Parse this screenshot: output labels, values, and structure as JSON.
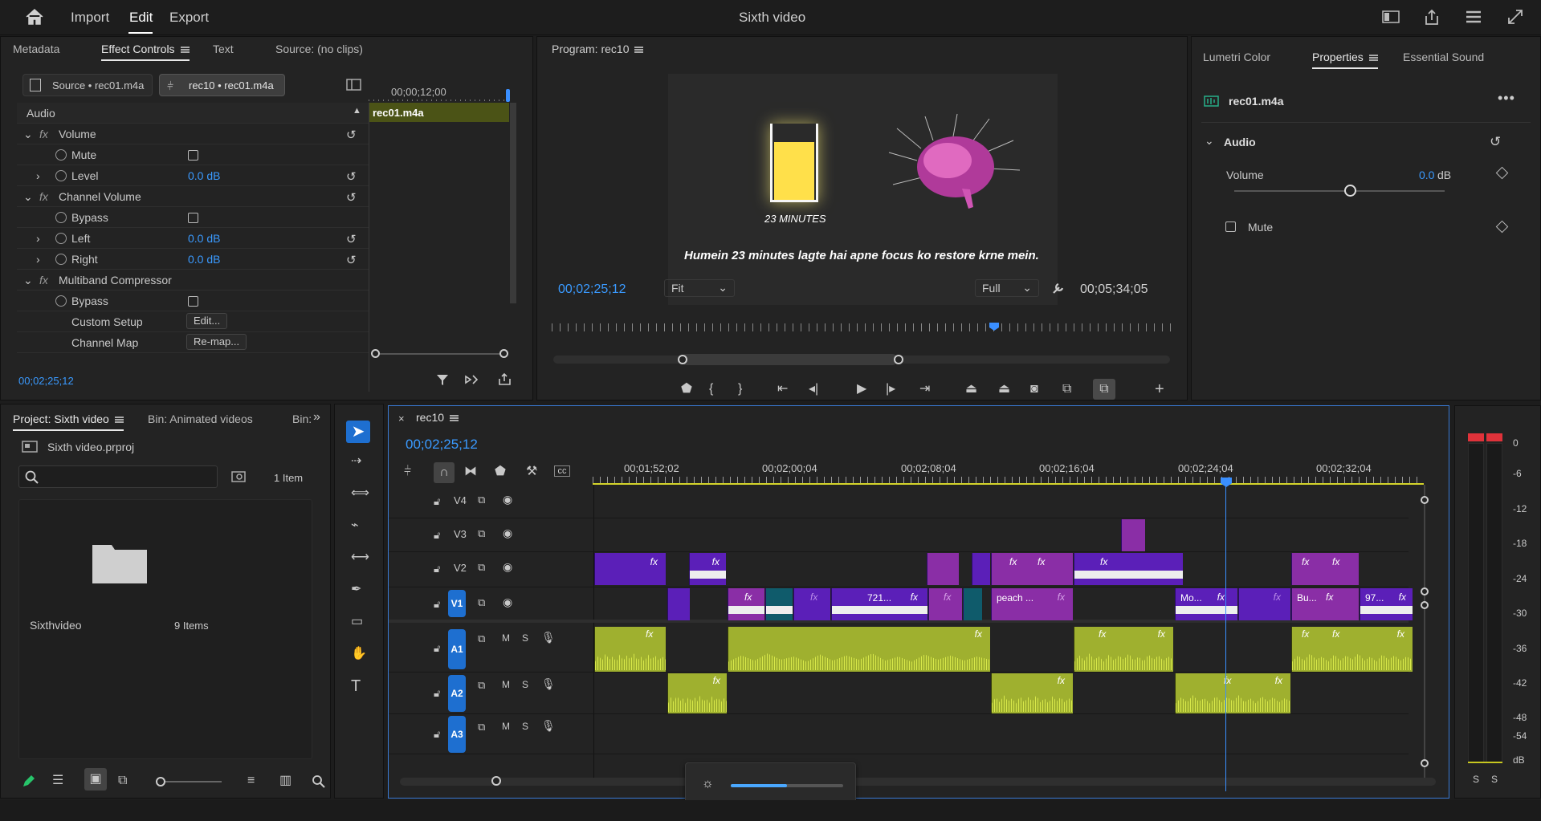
{
  "topbar": {
    "import": "Import",
    "edit": "Edit",
    "export": "Export",
    "title": "Sixth video"
  },
  "effect_controls": {
    "tabs": [
      "Metadata",
      "Effect Controls",
      "Text",
      "Source: (no clips)"
    ],
    "source_tab": "Source • rec01.m4a",
    "seq_tab": "rec10 • rec01.m4a",
    "mini_time": "00;00;12;00",
    "mini_clip": "rec01.m4a",
    "section": "Audio",
    "rows": {
      "volume": "Volume",
      "mute": "Mute",
      "level": "Level",
      "level_val": "0.0 dB",
      "channel_volume": "Channel Volume",
      "bypass": "Bypass",
      "left": "Left",
      "left_val": "0.0 dB",
      "right": "Right",
      "right_val": "0.0 dB",
      "multiband": "Multiband Compressor",
      "bypass2": "Bypass",
      "custom_setup": "Custom Setup",
      "edit_btn": "Edit...",
      "channel_map": "Channel Map",
      "remap_btn": "Re-map..."
    },
    "timecode": "00;02;25;12"
  },
  "program": {
    "title": "Program: rec10",
    "glass_caption": "23 MINUTES",
    "subtitle": "Humein 23 minutes lagte hai apne focus ko restore krne mein.",
    "timecode": "00;02;25;12",
    "fit": "Fit",
    "full": "Full",
    "duration": "00;05;34;05"
  },
  "properties": {
    "tabs": [
      "Lumetri Color",
      "Properties",
      "Essential Sound"
    ],
    "clip": "rec01.m4a",
    "section": "Audio",
    "volume_label": "Volume",
    "volume_val": "0.0",
    "volume_unit": "dB",
    "mute": "Mute",
    "volume_level": 0.55
  },
  "project": {
    "tabs": [
      "Project: Sixth video",
      "Bin: Animated videos",
      "Bin:"
    ],
    "file": "Sixth video.prproj",
    "count": "1 Item",
    "folder_name": "Sixthvideo",
    "folder_count": "9 Items"
  },
  "timeline": {
    "seq": "rec10",
    "timecode": "00;02;25;12",
    "ruler": [
      "00;01;52;02",
      "00;02;00;04",
      "00;02;08;04",
      "00;02;16;04",
      "00;02;24;04",
      "00;02;32;04"
    ],
    "video_tracks": [
      "V4",
      "V3",
      "V2",
      "V1"
    ],
    "audio_tracks": [
      "A1",
      "A2",
      "A3"
    ],
    "ms": [
      "M",
      "S"
    ],
    "clip_names": {
      "c721": "721...",
      "peach": "peach ...",
      "mo": "Mo...",
      "bu": "Bu...",
      "c97": "97..."
    }
  },
  "meter": {
    "ticks": [
      "0",
      "-6",
      "-12",
      "-18",
      "-24",
      "-30",
      "-36",
      "-42",
      "-48",
      "-54",
      "dB"
    ],
    "solo": [
      "S",
      "S"
    ]
  },
  "colors": {
    "accent": "#3a9aff",
    "video_clip": "#5b1fb8",
    "audio_clip": "#9fb02f",
    "playhead": "#3a8fff"
  }
}
